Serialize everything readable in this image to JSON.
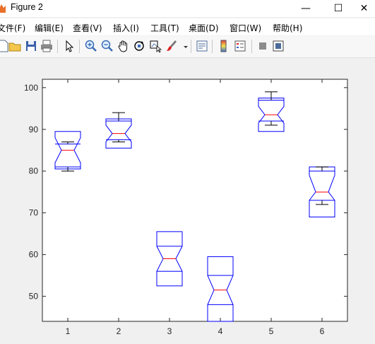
{
  "window": {
    "title": "Figure 2",
    "minimize_glyph": "—",
    "maximize_glyph": "☐",
    "close_glyph": "✕"
  },
  "menu": [
    "文件(F)",
    "编辑(E)",
    "查看(V)",
    "插入(I)",
    "工具(T)",
    "桌面(D)",
    "窗口(W)",
    "帮助(H)"
  ],
  "toolbar": {
    "icons": [
      "new-figure-icon",
      "open-file-icon",
      "save-icon",
      "print-icon",
      "edit-plot-arrow-icon",
      "zoom-in-icon",
      "zoom-out-icon",
      "pan-hand-icon",
      "rotate-3d-icon",
      "data-cursor-icon",
      "brush-icon",
      "brush-dropdown-icon",
      "link-plot-icon",
      "colorbar-icon",
      "legend-icon",
      "hide-plot-tools-icon",
      "show-plot-tools-icon"
    ]
  },
  "colors": {
    "box": "#0000ff",
    "median": "#ff0000",
    "whisker": "#000000",
    "axes_bg": "#ffffff"
  },
  "chart_data": {
    "type": "boxplot",
    "notched": true,
    "categories": [
      "1",
      "2",
      "3",
      "4",
      "5",
      "6"
    ],
    "xlim": [
      0.5,
      6.5
    ],
    "ylim": [
      44,
      102
    ],
    "yticks": [
      50,
      60,
      70,
      80,
      90,
      100
    ],
    "grid": false,
    "boxes": [
      {
        "x": "1",
        "whisker_low": 80,
        "q1": 81,
        "notch_low": 82,
        "median": 85,
        "notch_high": 88,
        "q3": 86.5,
        "whisker_high": 87,
        "box_low": 80.5,
        "box_high": 89.5
      },
      {
        "x": "2",
        "whisker_low": 87,
        "q1": 87.5,
        "notch_low": 87,
        "median": 89,
        "notch_high": 91,
        "q3": 92,
        "whisker_high": 94,
        "box_low": 85.5,
        "box_high": 92.5
      },
      {
        "x": "3",
        "whisker_low": null,
        "q1": 56,
        "notch_low": 56,
        "median": 59,
        "notch_high": 62,
        "q3": 62,
        "whisker_high": null,
        "box_low": 52.5,
        "box_high": 65.5
      },
      {
        "x": "4",
        "whisker_low": null,
        "q1": 48,
        "notch_low": 48,
        "median": 51.5,
        "notch_high": 55,
        "q3": 55,
        "whisker_high": null,
        "box_low": 44,
        "box_high": 59.5
      },
      {
        "x": "5",
        "whisker_low": 91,
        "q1": 92,
        "notch_low": 91.5,
        "median": 93.5,
        "notch_high": 95.5,
        "q3": 97,
        "whisker_high": 99,
        "box_low": 89.5,
        "box_high": 97.5
      },
      {
        "x": "6",
        "whisker_low": 72,
        "q1": 73,
        "notch_low": 73,
        "median": 75,
        "notch_high": 79,
        "q3": 80,
        "whisker_high": 81,
        "box_low": 69,
        "box_high": 81
      }
    ]
  }
}
